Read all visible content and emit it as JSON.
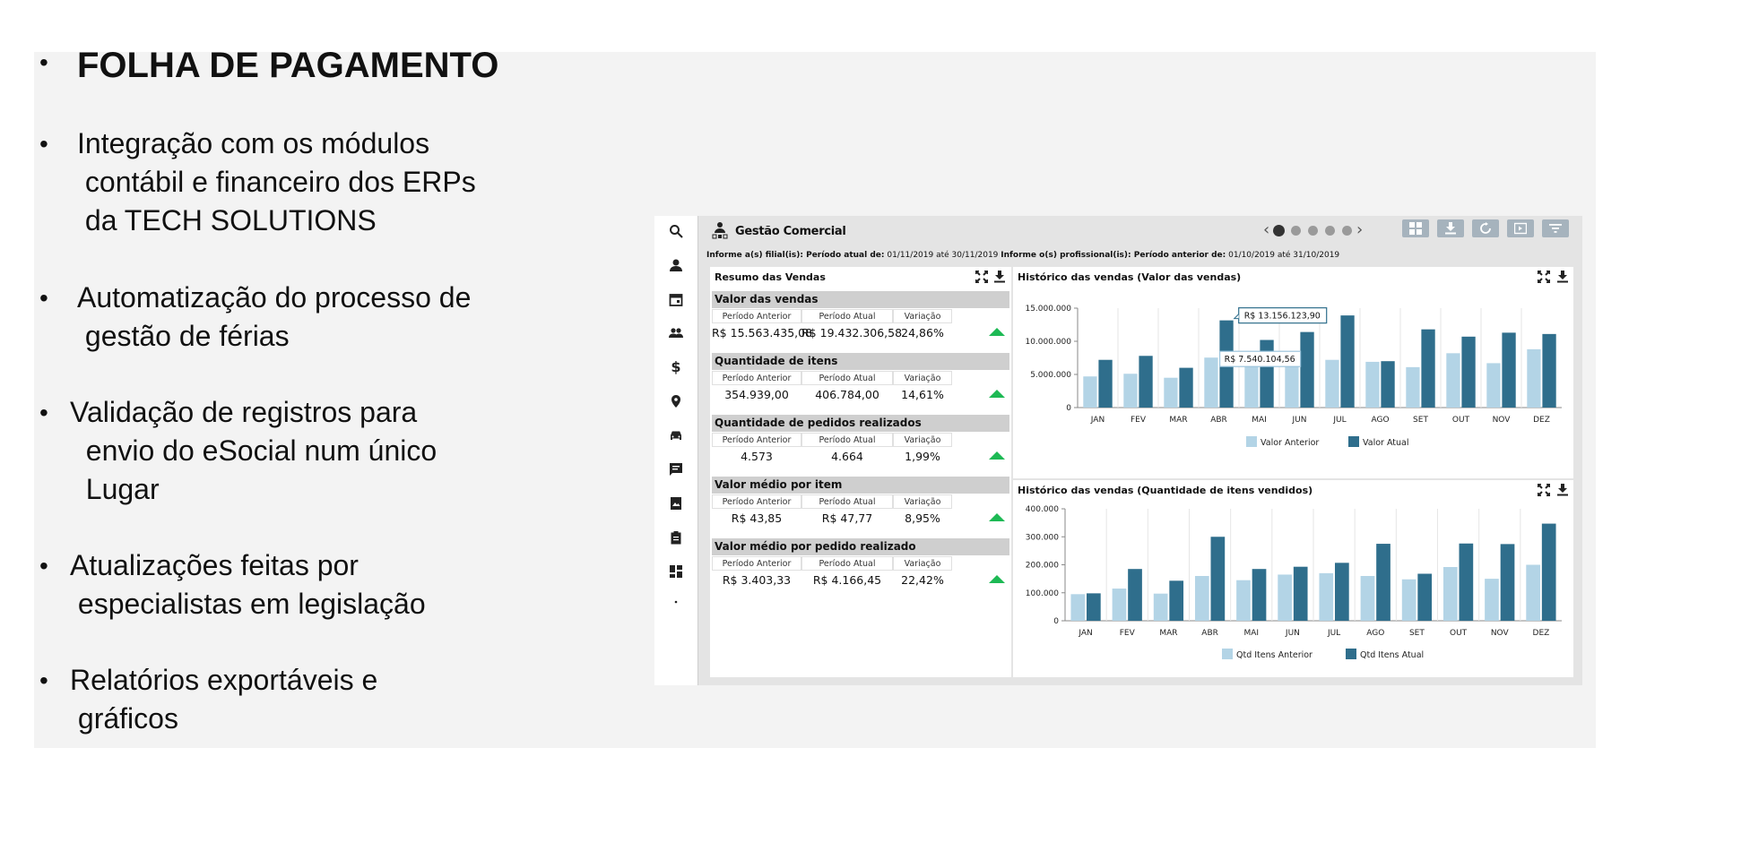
{
  "slide": {
    "bullets": [
      {
        "text": "FOLHA DE PAGAMENTO",
        "bold": true
      },
      {
        "text": "Integração com os módulos\n contábil e financeiro dos ERPs\n da TECH SOLUTIONS"
      },
      {
        "text": "Automatização do processo de\n gestão de férias"
      },
      {
        "text": "Validação de registros para\n  envio do eSocial num único\n  Lugar"
      },
      {
        "text": "Atualizações feitas por\n especialistas em legislação"
      },
      {
        "text": "Relatórios exportáveis e\n gráficos"
      }
    ],
    "bullet_char": "•"
  },
  "app": {
    "title": "Gestão Comercial",
    "pager": {
      "prev": "‹",
      "next": "›",
      "pages": 5,
      "active": 0
    },
    "toolbar": [
      "layout-icon",
      "download-icon",
      "refresh-icon",
      "play-icon",
      "filter-icon"
    ],
    "sidebar_icons": [
      "search-icon",
      "person-icon",
      "calendar-icon",
      "people-icon",
      "dollar-icon",
      "location-icon",
      "car-icon",
      "chat-icon",
      "book-icon",
      "clipboard-icon",
      "dashboard-icon",
      "dot-icon"
    ],
    "info": {
      "l1": "Informe a(s) filial(is): Período atual de:",
      "v1": " 01/11/2019 até 30/11/2019 ",
      "l2": "Informe o(s) profissional(is): Período anterior de:",
      "v2": " 01/10/2019 até 31/10/2019"
    },
    "summary": {
      "title": "Resumo das Vendas",
      "col_prev": "Período Anterior",
      "col_curr": "Período Atual",
      "col_var": "Variação",
      "sections": [
        {
          "title": "Valor das vendas",
          "prev": "R$ 15.563.435,08",
          "curr": "R$ 19.432.306,58",
          "var": "24,86%"
        },
        {
          "title": "Quantidade de itens",
          "prev": "354.939,00",
          "curr": "406.784,00",
          "var": "14,61%"
        },
        {
          "title": "Quantidade de pedidos realizados",
          "prev": "4.573",
          "curr": "4.664",
          "var": "1,99%"
        },
        {
          "title": "Valor médio por item",
          "prev": "R$ 43,85",
          "curr": "R$ 47,77",
          "var": "8,95%"
        },
        {
          "title": "Valor médio por pedido realizado",
          "prev": "R$ 3.403,33",
          "curr": "R$ 4.166,45",
          "var": "22,42%"
        }
      ],
      "up_color": "#1db954"
    }
  },
  "chart_data": [
    {
      "type": "bar",
      "title": "Histórico das vendas (Valor das vendas)",
      "categories": [
        "JAN",
        "FEV",
        "MAR",
        "ABR",
        "MAI",
        "JUN",
        "JUL",
        "AGO",
        "SET",
        "OUT",
        "NOV",
        "DEZ"
      ],
      "series": [
        {
          "name": "Valor Anterior",
          "color": "#b3d4e6",
          "values": [
            4700000,
            5100000,
            4500000,
            7540104.56,
            6400000,
            6600000,
            7200000,
            6900000,
            6100000,
            8200000,
            6700000,
            8800000
          ]
        },
        {
          "name": "Valor Atual",
          "color": "#2f6e8c",
          "values": [
            7200000,
            7800000,
            6000000,
            13156123.9,
            10200000,
            11400000,
            13900000,
            7000000,
            11800000,
            10700000,
            11300000,
            11100000
          ]
        }
      ],
      "ylim": [
        0,
        15000000
      ],
      "yticks": [
        "0",
        "5.000.000",
        "10.000.000",
        "15.000.000"
      ],
      "tooltips": [
        "R$ 13.156.123,90",
        "R$ 7.540.104,56"
      ],
      "legend": "bottom"
    },
    {
      "type": "bar",
      "title": "Histórico das vendas (Quantidade de itens vendidos)",
      "categories": [
        "JAN",
        "FEV",
        "MAR",
        "ABR",
        "MAI",
        "JUN",
        "JUL",
        "AGO",
        "SET",
        "OUT",
        "NOV",
        "DEZ"
      ],
      "series": [
        {
          "name": "Qtd Itens Anterior",
          "color": "#b3d4e6",
          "values": [
            95000,
            115000,
            97000,
            160000,
            145000,
            165000,
            170000,
            160000,
            148000,
            192000,
            150000,
            200000
          ]
        },
        {
          "name": "Qtd Itens Atual",
          "color": "#2f6e8c",
          "values": [
            98000,
            185000,
            143000,
            300000,
            185000,
            193000,
            207000,
            275000,
            168000,
            276000,
            274000,
            347000
          ]
        }
      ],
      "ylim": [
        0,
        400000
      ],
      "yticks": [
        "0",
        "100.000",
        "200.000",
        "300.000",
        "400.000"
      ],
      "legend": "bottom"
    }
  ]
}
